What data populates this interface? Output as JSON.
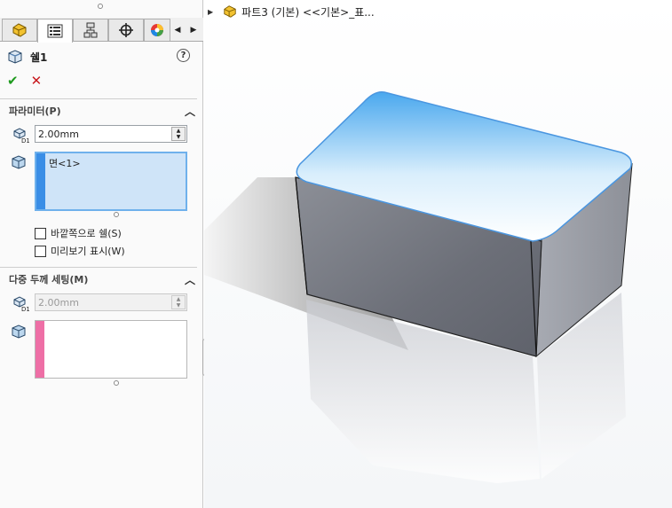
{
  "panel": {
    "tabs": [
      {
        "name": "feature-manager",
        "icon": "part-feature-icon"
      },
      {
        "name": "property-manager",
        "icon": "property-list-icon"
      },
      {
        "name": "configuration-manager",
        "icon": "configuration-icon"
      },
      {
        "name": "dimxpert-manager",
        "icon": "crosshair-icon"
      },
      {
        "name": "display-manager",
        "icon": "color-wheel-icon"
      }
    ],
    "title": "쉘1",
    "help_label": "?",
    "ok_symbol": "✔",
    "cancel_symbol": "✕",
    "parameters": {
      "header": "파라미터(P)",
      "thickness_value": "2.00mm",
      "faces": [
        "면<1>"
      ],
      "checkbox_outward": "바깥쪽으로 쉘(S)",
      "checkbox_preview": "미리보기 표시(W)"
    },
    "multi_thickness": {
      "header": "다중 두께 세팅(M)",
      "thickness_value": "2.00mm",
      "faces": []
    }
  },
  "colors": {
    "accent_blue": "#3a8ee6",
    "accent_pink": "#ee6fa6",
    "selection_fill": "#cfe4f8"
  },
  "viewport": {
    "tree_label": "파트3 (기본) <<기본>_표..."
  }
}
